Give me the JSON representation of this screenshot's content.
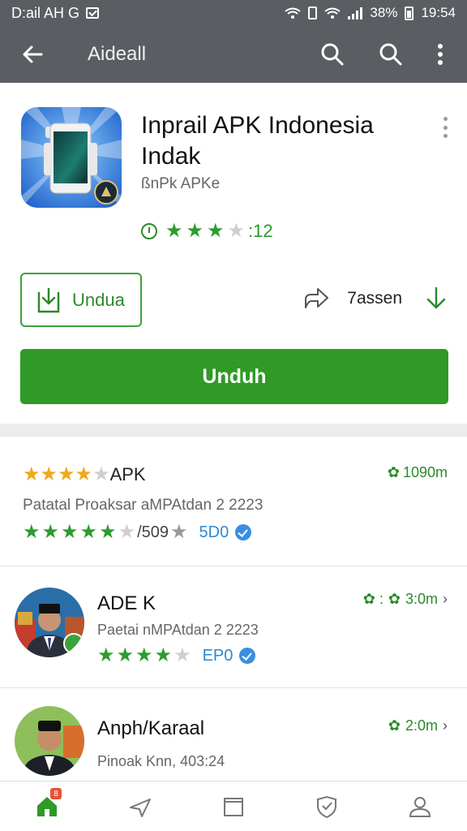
{
  "status_bar": {
    "carrier": "D:ail AH G",
    "battery": "38%",
    "time": "19:54"
  },
  "app_bar": {
    "title": "Aideall"
  },
  "app": {
    "title": "Inprail APK Indonesia Indak",
    "subtitle": "ßnPk APKe",
    "rating_stars": 3,
    "rating_count": ":12",
    "download_outline_label": "Undua",
    "share_count": "7assen",
    "download_label": "Unduh"
  },
  "list": [
    {
      "title": "APK",
      "size": "1090m",
      "description": "Patatal Proaksar aMPAtdan 2 2223",
      "rating": "/509",
      "tag": "5D0",
      "stars": 4
    },
    {
      "title": "ADE K",
      "size": "3:0m",
      "description": "Paetai nMPAtdan 2 2223",
      "tag": "EP0",
      "stars": 4
    },
    {
      "title": "Anph/Karaal",
      "size": "2:0m",
      "description": "Pinoak Knn,  403:24"
    }
  ],
  "colors": {
    "accent_green": "#2f9a26",
    "app_bar": "#5a5e63",
    "star_yellow": "#f0a81c",
    "link_blue": "#2a8ad6"
  },
  "icons": {
    "back": "arrow-left-icon",
    "search": "search-icon",
    "more": "more-vert-icon",
    "download": "download-icon",
    "share": "share-icon",
    "home": "home-icon",
    "apps": "apps-icon",
    "library": "library-icon",
    "shield": "shield-icon",
    "profile": "profile-icon"
  },
  "bottom_nav": {
    "home_badge": "8"
  }
}
